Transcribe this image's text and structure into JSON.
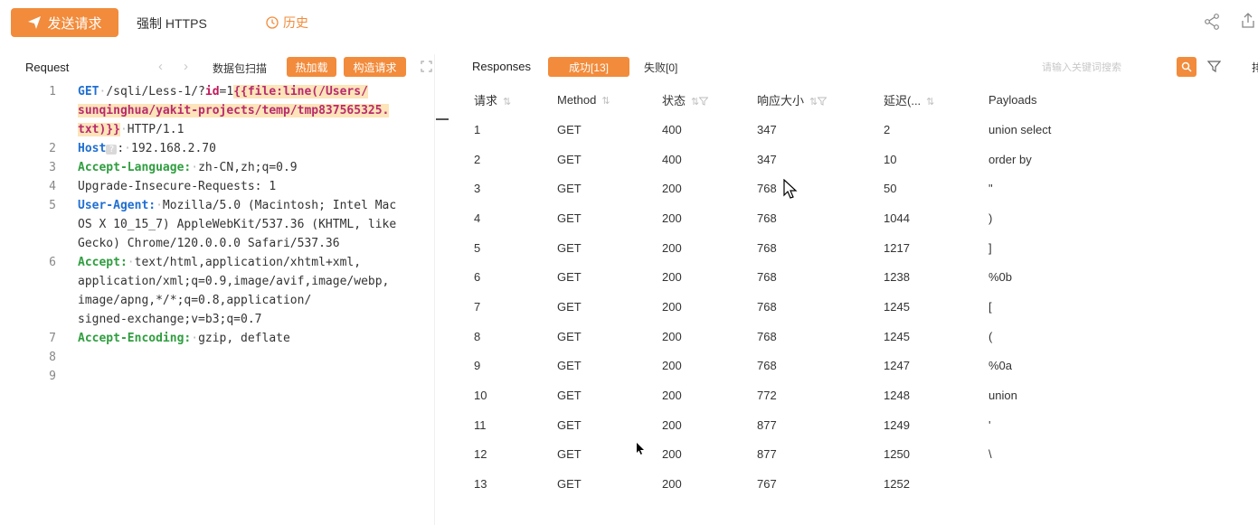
{
  "topbar": {
    "send_label": "发送请求",
    "https_label": "强制 HTTPS",
    "history_label": "历史",
    "accent": "#f28b3b"
  },
  "request": {
    "title": "Request",
    "scan_label": "数据包扫描",
    "hot_label": "热加载",
    "build_label": "构造请求",
    "lines": [
      {
        "n": "1",
        "method": "GET",
        "path": "/sqli/Less-1/?",
        "param": "id",
        "eq": "=1",
        "tag1": "{{file:line(",
        "tag2": "/Users/"
      },
      {
        "n": "",
        "cont": "sunqinghua/yakit-projects/temp/tmp837565325."
      },
      {
        "n": "",
        "cont_a": "txt)}}",
        "cont_b": "HTTP/1.1"
      },
      {
        "n": "2",
        "key": "Host",
        "hint": "?",
        "val": "192.168.2.70"
      },
      {
        "n": "3",
        "key": "Accept-Language:",
        "val": "zh-CN,zh;q=0.9"
      },
      {
        "n": "4",
        "plain": "Upgrade-Insecure-Requests: 1"
      },
      {
        "n": "5",
        "key": "User-Agent:",
        "val": "Mozilla/5.0 (Macintosh; Intel Mac"
      },
      {
        "n": "",
        "plain": "OS X 10_15_7) AppleWebKit/537.36 (KHTML, like"
      },
      {
        "n": "",
        "plain": "Gecko) Chrome/120.0.0.0 Safari/537.36"
      },
      {
        "n": "6",
        "key": "Accept:",
        "val": "text/html,application/xhtml+xml,"
      },
      {
        "n": "",
        "plain": "application/xml;q=0.9,image/avif,image/webp,"
      },
      {
        "n": "",
        "plain": "image/apng,*/*;q=0.8,application/"
      },
      {
        "n": "",
        "plain": "signed-exchange;v=b3;q=0.7"
      },
      {
        "n": "7",
        "key": "Accept-Encoding:",
        "val": "gzip, deflate"
      },
      {
        "n": "8"
      },
      {
        "n": "9"
      }
    ]
  },
  "responses": {
    "title": "Responses",
    "success_tab": "成功[13]",
    "fail_tab": "失败[0]",
    "search_placeholder": "请输入关键词搜索",
    "cut_label": "排",
    "columns": [
      "请求",
      "Method",
      "状态",
      "响应大小",
      "延迟(...",
      "Payloads"
    ],
    "rows": [
      {
        "id": "1",
        "method": "GET",
        "status": "400",
        "size": "347",
        "delay": "2",
        "payload": "union select"
      },
      {
        "id": "2",
        "method": "GET",
        "status": "400",
        "size": "347",
        "delay": "10",
        "payload": "order by"
      },
      {
        "id": "3",
        "method": "GET",
        "status": "200",
        "size": "768",
        "delay": "50",
        "payload": "\""
      },
      {
        "id": "4",
        "method": "GET",
        "status": "200",
        "size": "768",
        "delay": "1044",
        "payload": ")"
      },
      {
        "id": "5",
        "method": "GET",
        "status": "200",
        "size": "768",
        "delay": "1217",
        "payload": "]"
      },
      {
        "id": "6",
        "method": "GET",
        "status": "200",
        "size": "768",
        "delay": "1238",
        "payload": "%0b"
      },
      {
        "id": "7",
        "method": "GET",
        "status": "200",
        "size": "768",
        "delay": "1245",
        "payload": "["
      },
      {
        "id": "8",
        "method": "GET",
        "status": "200",
        "size": "768",
        "delay": "1245",
        "payload": "("
      },
      {
        "id": "9",
        "method": "GET",
        "status": "200",
        "size": "768",
        "delay": "1247",
        "payload": "%0a"
      },
      {
        "id": "10",
        "method": "GET",
        "status": "200",
        "size": "772",
        "delay": "1248",
        "payload": "union"
      },
      {
        "id": "11",
        "method": "GET",
        "status": "200",
        "size": "877",
        "delay": "1249",
        "payload": "'"
      },
      {
        "id": "12",
        "method": "GET",
        "status": "200",
        "size": "877",
        "delay": "1250",
        "payload": "\\"
      },
      {
        "id": "13",
        "method": "GET",
        "status": "200",
        "size": "767",
        "delay": "1252",
        "payload": ""
      }
    ]
  }
}
